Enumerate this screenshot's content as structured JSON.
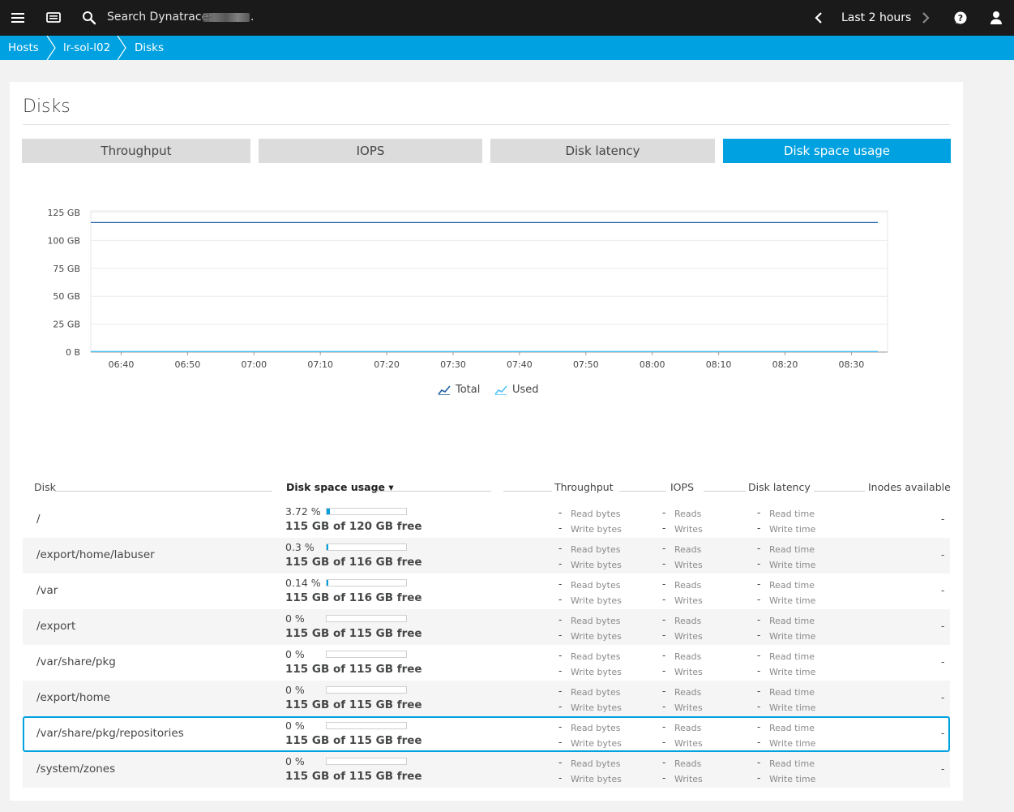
{
  "topbar": {
    "search_placeholder": "Search Dynatrace:",
    "search_suffix": ".",
    "timeframe": "Last 2 hours"
  },
  "breadcrumb": [
    "Hosts",
    "lr-sol-l02",
    "Disks"
  ],
  "page": {
    "title": "Disks",
    "tabs": [
      "Throughput",
      "IOPS",
      "Disk latency",
      "Disk space usage"
    ],
    "active_tab": 3
  },
  "chart_data": {
    "type": "line",
    "y_tick_labels": [
      "125 GB",
      "100 GB",
      "75 GB",
      "50 GB",
      "25 GB",
      "0 B"
    ],
    "x": [
      "06:40",
      "06:50",
      "07:00",
      "07:10",
      "07:20",
      "07:30",
      "07:40",
      "07:50",
      "08:00",
      "08:10",
      "08:20",
      "08:30"
    ],
    "ylim": [
      0,
      125
    ],
    "grid": true,
    "legend_position": "bottom-center",
    "series": [
      {
        "name": "Total",
        "color": "#1f5fa0",
        "values": [
          116,
          116,
          116,
          116,
          116,
          116,
          116,
          116,
          116,
          116,
          116,
          116
        ]
      },
      {
        "name": "Used",
        "color": "#4fc3f7",
        "values": [
          0.5,
          0.5,
          0.5,
          0.5,
          0.5,
          0.5,
          0.5,
          0.5,
          0.5,
          0.5,
          0.5,
          0.5
        ]
      }
    ]
  },
  "table": {
    "headers": [
      "Disk",
      "Disk space usage ▾",
      "Throughput",
      "IOPS",
      "Disk latency",
      "Inodes available"
    ],
    "metric_labels": {
      "throughput": [
        "Read bytes",
        "Write bytes"
      ],
      "iops": [
        "Reads",
        "Writes"
      ],
      "latency": [
        "Read time",
        "Write time"
      ]
    },
    "dash": "-",
    "rows": [
      {
        "disk": "/",
        "pct_text": "3.72 %",
        "pct": 3.72,
        "free": "115 GB of 120 GB free"
      },
      {
        "disk": "/export/home/labuser",
        "pct_text": "0.3 %",
        "pct": 0.3,
        "free": "115 GB of 116 GB free"
      },
      {
        "disk": "/var",
        "pct_text": "0.14 %",
        "pct": 0.14,
        "free": "115 GB of 116 GB free"
      },
      {
        "disk": "/export",
        "pct_text": "0 %",
        "pct": 0,
        "free": "115 GB of 115 GB free"
      },
      {
        "disk": "/var/share/pkg",
        "pct_text": "0 %",
        "pct": 0,
        "free": "115 GB of 115 GB free"
      },
      {
        "disk": "/export/home",
        "pct_text": "0 %",
        "pct": 0,
        "free": "115 GB of 115 GB free"
      },
      {
        "disk": "/var/share/pkg/repositories",
        "pct_text": "0 %",
        "pct": 0,
        "free": "115 GB of 115 GB free"
      },
      {
        "disk": "/system/zones",
        "pct_text": "0 %",
        "pct": 0,
        "free": "115 GB of 115 GB free"
      }
    ],
    "selected_row": 6
  },
  "colors": {
    "accent": "#00a1e0",
    "topbar": "#1a1a1a"
  },
  "icons": [
    "menu-icon",
    "dashboard-icon",
    "search-icon",
    "chevron-left-icon",
    "chevron-right-icon",
    "help-icon",
    "user-icon",
    "line-chart-icon"
  ]
}
